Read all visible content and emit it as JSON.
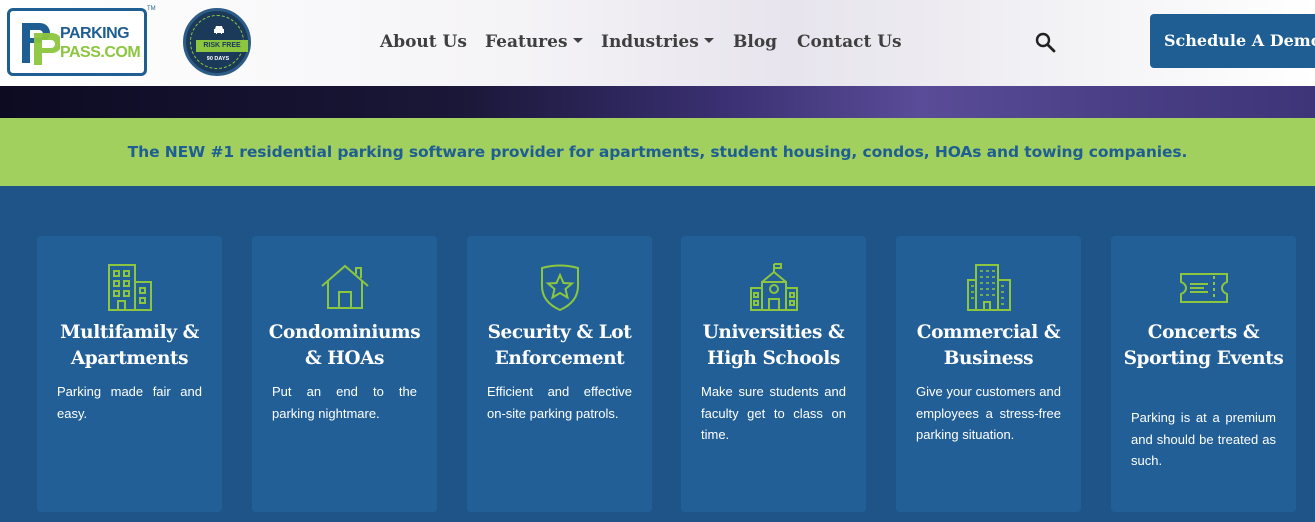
{
  "header": {
    "logo": {
      "line1": "PARKING",
      "line2": "PASS.COM",
      "tm": "TM"
    },
    "badge": {
      "ribbon": "RISK FREE",
      "days": "90 DAYS"
    },
    "nav": [
      {
        "label": "About Us",
        "dropdown": false
      },
      {
        "label": "Features",
        "dropdown": true
      },
      {
        "label": "Industries",
        "dropdown": true
      },
      {
        "label": "Blog",
        "dropdown": false
      },
      {
        "label": "Contact Us",
        "dropdown": false
      }
    ],
    "search_icon": "search-icon",
    "cta_label": "Schedule A Demo"
  },
  "banner": {
    "text": "The NEW #1 residential parking software provider for apartments, student housing, condos, HOAs and towing companies."
  },
  "cards": [
    {
      "icon": "building-icon",
      "title": "Multifamily & Apartments",
      "desc": "Parking made fair and easy."
    },
    {
      "icon": "house-icon",
      "title": "Condominiums & HOAs",
      "desc": "Put an end to the parking nightmare."
    },
    {
      "icon": "shield-star-icon",
      "title": "Security & Lot Enforcement",
      "desc": "Efficient and effective on-site parking patrols."
    },
    {
      "icon": "school-icon",
      "title": "Universities & High Schools",
      "desc": "Make sure students and faculty get to class on time."
    },
    {
      "icon": "office-building-icon",
      "title": "Commercial & Business",
      "desc": "Give your customers and employees a stress-free parking situation."
    },
    {
      "icon": "ticket-icon",
      "title": "Concerts & Sporting Events",
      "desc": "Parking is at a premium and should be treated as such."
    }
  ],
  "colors": {
    "brand_blue": "#1f5e93",
    "brand_green": "#8cc63f",
    "banner_green": "#a2d05f",
    "section_bg": "#1e5487",
    "card_bg": "#225f97",
    "icon_green": "#8cc63f"
  }
}
